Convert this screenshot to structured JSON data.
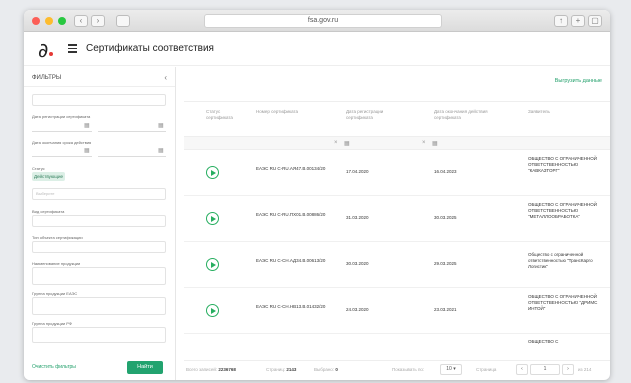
{
  "browser": {
    "url": "fsa.gov.ru"
  },
  "header": {
    "title": "Сертификаты соответствия"
  },
  "sidebar": {
    "title": "ФИЛЬТРЫ",
    "labels": {
      "reg_date": "Дата регистрации сертификата",
      "end_date": "Дата окончания срока действия",
      "status": "Статус",
      "scheme": "Вид сертификата",
      "object": "Тип объекта сертификации",
      "product_name": "Наименование продукции",
      "eaeu_code": "Группа продукции ЕАЭС",
      "rf_code": "Группа продукции РФ"
    },
    "status_chip": "Действующие",
    "select_placeholder": "Выберите",
    "reset": "Очистить фильтры",
    "apply": "Найти"
  },
  "main": {
    "export": "Выгрузить данные",
    "columns": [
      "Статус сертификата",
      "Номер сертификата",
      "Дата регистрации сертификата",
      "Дата окончания действия сертификата",
      "Заявитель"
    ],
    "rows": [
      {
        "number": "ЕАЭС RU С-RU.АЯ47.В.00134/20",
        "reg_date": "17.04.2020",
        "end_date": "16.04.2023",
        "applicant": "ОБЩЕСТВО С ОГРАНИЧЕННОЙ ОТВЕТСТВЕННОСТЬЮ \"КАВКАЗТОРГ\""
      },
      {
        "number": "ЕАЭС RU С-RU.ПХ01.В.00886/20",
        "reg_date": "31.03.2020",
        "end_date": "30.03.2025",
        "applicant": "ОБЩЕСТВО С ОГРАНИЧЕННОЙ ОТВЕТСТВЕННОСТЬЮ \"МЕТАЛЛООБРАБОТКА\""
      },
      {
        "number": "ЕАЭС RU С-СН.АД34.В.00613/20",
        "reg_date": "30.03.2020",
        "end_date": "29.03.2025",
        "applicant": "Общество с ограниченной ответственностью \"ТрансКарго Логистик\""
      },
      {
        "number": "ЕАЭС RU С-СН.НВ13.В.01432/20",
        "reg_date": "24.03.2020",
        "end_date": "23.03.2021",
        "applicant": "ОБЩЕСТВО С ОГРАНИЧЕННОЙ ОТВЕТСТВЕННОСТЬЮ \"ДРИМС ИНТОЙ\""
      },
      {
        "number": "",
        "reg_date": "",
        "end_date": "",
        "applicant": "ОБЩЕСТВО С"
      }
    ]
  },
  "footer": {
    "total_label": "Всего записей:",
    "total": "2236768",
    "pages_label": "Страниц:",
    "pages": "2143",
    "selected_label": "Выбрано:",
    "selected": "0",
    "per_page_label": "Показывать по:",
    "per_page": "10",
    "page_label": "Страница",
    "page": "1",
    "of_label": "из 214"
  }
}
